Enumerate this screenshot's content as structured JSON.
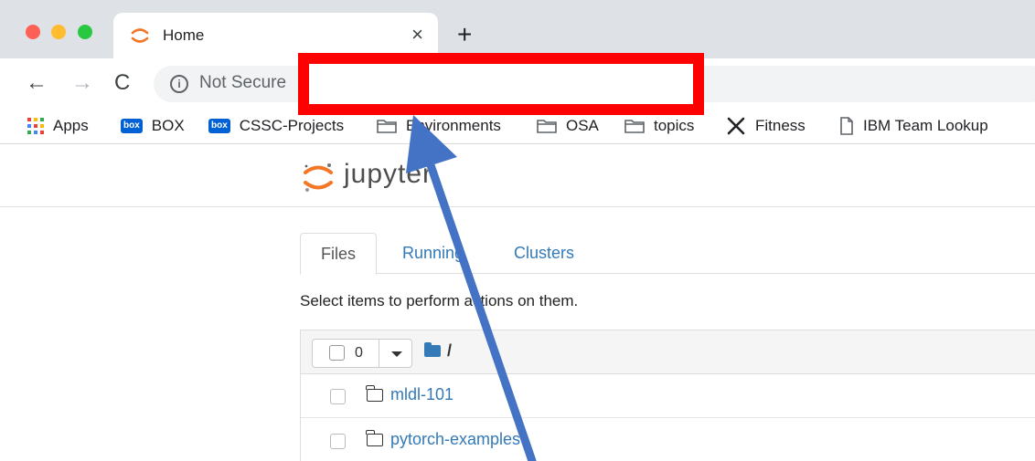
{
  "browser": {
    "tab": {
      "title": "Home",
      "close_glyph": "×",
      "favicon": "jupyter-logo-icon"
    },
    "new_tab_glyph": "+",
    "nav": {
      "back_glyph": "←",
      "forward_glyph": "→",
      "reload_glyph": "C"
    },
    "omnibox": {
      "security_label": "Not Secure",
      "info_glyph": "i"
    },
    "bookmarks": [
      {
        "label": "Apps",
        "icon": "apps-grid-icon"
      },
      {
        "label": "BOX",
        "icon": "box-icon"
      },
      {
        "label": "CSSC-Projects",
        "icon": "box-icon"
      },
      {
        "label": "Environments",
        "icon": "folder-icon"
      },
      {
        "label": "OSA",
        "icon": "folder-icon"
      },
      {
        "label": "topics",
        "icon": "folder-icon"
      },
      {
        "label": "Fitness",
        "icon": "fork-knife-icon"
      },
      {
        "label": "IBM Team Lookup",
        "icon": "page-icon"
      }
    ],
    "box_badge_text": "box"
  },
  "jupyter": {
    "logo_text": "jupyter",
    "tabs": [
      {
        "label": "Files",
        "active": true
      },
      {
        "label": "Running",
        "active": false
      },
      {
        "label": "Clusters",
        "active": false
      }
    ],
    "hint": "Select items to perform actions on them.",
    "selected_count": "0",
    "breadcrumb_root": "/",
    "items": [
      {
        "name": "mldl-101",
        "type": "folder"
      },
      {
        "name": "pytorch-examples",
        "type": "folder"
      }
    ]
  },
  "colors": {
    "tabstrip": "#dee1e6",
    "link": "#337ab7",
    "annotation_red": "#ff0000",
    "annotation_arrow": "#4472c4",
    "jupyter_orange": "#f37726"
  }
}
